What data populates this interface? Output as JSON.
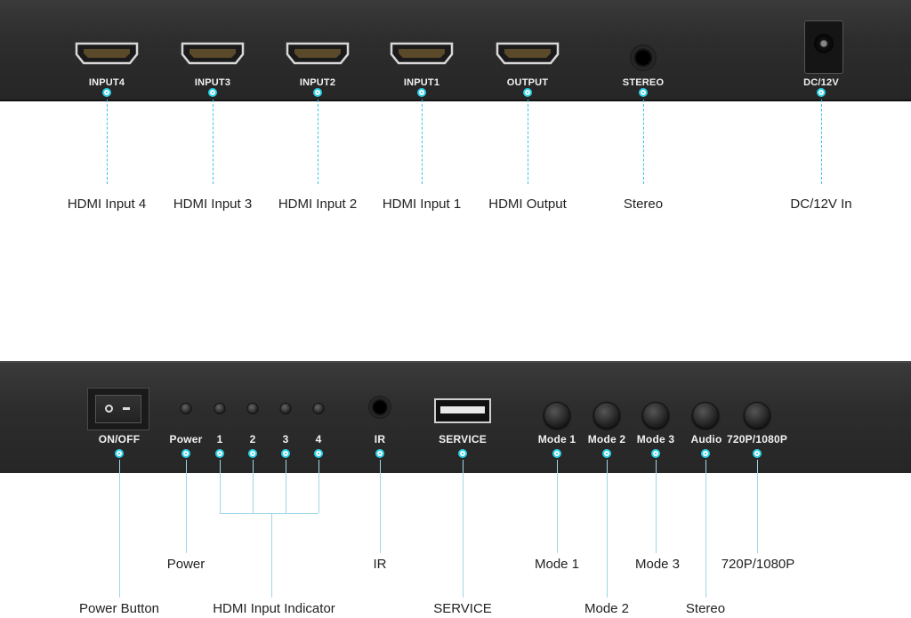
{
  "top_panel": {
    "ports": [
      {
        "label": "INPUT4",
        "caption": "HDMI Input 4"
      },
      {
        "label": "INPUT3",
        "caption": "HDMI Input 3"
      },
      {
        "label": "INPUT2",
        "caption": "HDMI Input 2"
      },
      {
        "label": "INPUT1",
        "caption": "HDMI Input 1"
      },
      {
        "label": "OUTPUT",
        "caption": "HDMI Output"
      },
      {
        "label": "STEREO",
        "caption": "Stereo"
      },
      {
        "label": "DC/12V",
        "caption": "DC/12V In"
      }
    ]
  },
  "bottom_panel": {
    "labels": {
      "on_off": "ON/OFF",
      "power": "Power",
      "ind1": "1",
      "ind2": "2",
      "ind3": "3",
      "ind4": "4",
      "ir": "IR",
      "service": "SERVICE",
      "mode1": "Mode 1",
      "mode2": "Mode 2",
      "mode3": "Mode 3",
      "audio": "Audio",
      "resolution": "720P/1080P"
    },
    "captions": {
      "power_button": "Power Button",
      "power": "Power",
      "hdmi_input_indicator": "HDMI Input Indicator",
      "ir": "IR",
      "service": "SERVICE",
      "mode1": "Mode 1",
      "mode2": "Mode 2",
      "mode3": "Mode 3",
      "stereo": "Stereo",
      "resolution": "720P/1080P"
    }
  },
  "colors": {
    "panel": "#2d2d2d",
    "accent": "#2bd0e6",
    "label_text": "#f2f2f2",
    "caption_text": "#222222"
  }
}
